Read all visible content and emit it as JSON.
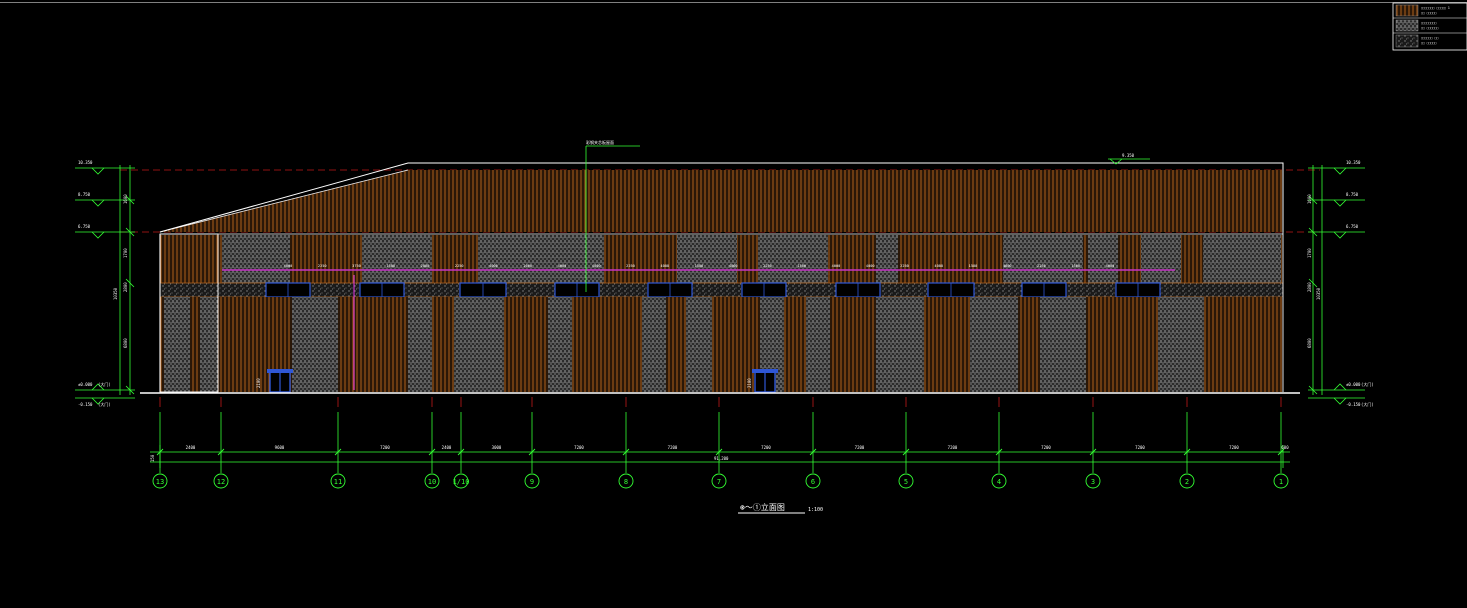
{
  "drawing": {
    "title_text": "⊛～①立面图",
    "scale_text": "1:100",
    "roof_note": "彩钢夹芯板屋面",
    "ridge_level": "9.350"
  },
  "legend": {
    "rows": [
      {
        "name": "legend-row-1",
        "line1": "□□□□□□□  □□□□□ 1",
        "line2": "□□  □□□□□"
      },
      {
        "name": "legend-row-2",
        "line1": "□□□□□□□□",
        "line2": "□□  □□□□□□"
      },
      {
        "name": "legend-row-3",
        "line1": "□□□□□□ □□",
        "line2": "□□  □□□□□"
      }
    ]
  },
  "levels_left": [
    {
      "name": "level-top-left",
      "text": "10.350"
    },
    {
      "name": "level-eave-left",
      "text": "8.750"
    },
    {
      "name": "level-mid-left",
      "text": "6.750"
    },
    {
      "name": "level-ground-left",
      "text": "±0.000",
      "note": "(大门)"
    },
    {
      "name": "level-base-left",
      "text": "-0.150",
      "note": "(大门)"
    }
  ],
  "levels_right": [
    {
      "name": "level-top-right",
      "text": "10.350"
    },
    {
      "name": "level-eave-right",
      "text": "8.750"
    },
    {
      "name": "level-mid-right",
      "text": "6.750"
    },
    {
      "name": "level-ground-right",
      "text": "±0.000",
      "note": "(大门)"
    },
    {
      "name": "level-base-right",
      "text": "-0.150",
      "note": "(大门)"
    }
  ],
  "vertical_dims_left": [
    "1600",
    "1700",
    "2800",
    "6800",
    "10350"
  ],
  "vertical_dims_right": [
    "1600",
    "1700",
    "2800",
    "6800",
    "10350"
  ],
  "window_dims": [
    "4000",
    "2250",
    "3750",
    "1500",
    "2000",
    "2250",
    "4000",
    "2000",
    "4000",
    "4000",
    "2250",
    "4000",
    "1500",
    "4000",
    "2250",
    "1500",
    "4000",
    "4000",
    "2250",
    "4000",
    "1500",
    "4000",
    "2250",
    "1500",
    "4000"
  ],
  "door_dim": "2100",
  "axis_labels": [
    "13",
    "12",
    "11",
    "10",
    "1/10",
    "9",
    "8",
    "7",
    "6",
    "5",
    "4",
    "3",
    "2",
    "1"
  ],
  "span_dims": [
    "2400",
    "9600",
    "7200",
    "2400",
    "3000",
    "7200",
    "7200",
    "7200",
    "7200",
    "7200",
    "7200",
    "7200",
    "7200",
    "600"
  ],
  "overall_dim": "91,200",
  "overall_side_dim": "150",
  "colors": {
    "green": "#33ff33",
    "panel_orange": "#b3631e",
    "panel_gray": "#8c8c8c",
    "magenta": "#c633c6",
    "window_blue": "#2f57d6",
    "red_dash": "#c01818",
    "white": "#ffffff"
  }
}
